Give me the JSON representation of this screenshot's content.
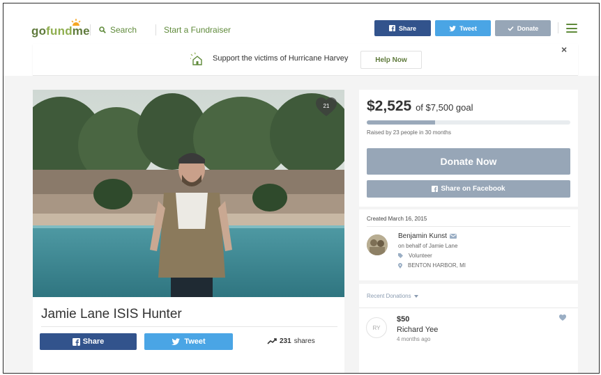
{
  "header": {
    "logo": {
      "go": "go",
      "fund": "fund",
      "me": "me"
    },
    "search_label": "Search",
    "start_label": "Start a Fundraiser",
    "share_label": "Share",
    "tweet_label": "Tweet",
    "donate_label": "Donate"
  },
  "banner": {
    "text": "Support the victims of Hurricane Harvey",
    "button": "Help Now",
    "close": "×"
  },
  "campaign": {
    "hearts": "21",
    "title": "Jamie Lane ISIS Hunter",
    "share_label": "Share",
    "tweet_label": "Tweet",
    "shares_count": "231",
    "shares_label": "shares"
  },
  "goal": {
    "raised": "$2,525",
    "of_goal": "of $7,500 goal",
    "progress_fraction": 0.337,
    "raised_by": "Raised by 23 people in 30 months",
    "donate_now": "Donate Now",
    "share_facebook": "Share on Facebook"
  },
  "organizer": {
    "created": "Created March 16, 2015",
    "name": "Benjamin Kunst",
    "behalf": "on behalf of Jamie Lane",
    "category": "Volunteer",
    "location": "BENTON HARBOR, MI"
  },
  "donations": {
    "header": "Recent Donations",
    "items": [
      {
        "initials": "RY",
        "amount": "$50",
        "name": "Richard Yee",
        "time": "4 months ago"
      }
    ]
  },
  "colors": {
    "brand_green": "#5f8a3a",
    "facebook": "#32538c",
    "twitter": "#4aa5e5",
    "muted_button": "#97a6b7"
  }
}
